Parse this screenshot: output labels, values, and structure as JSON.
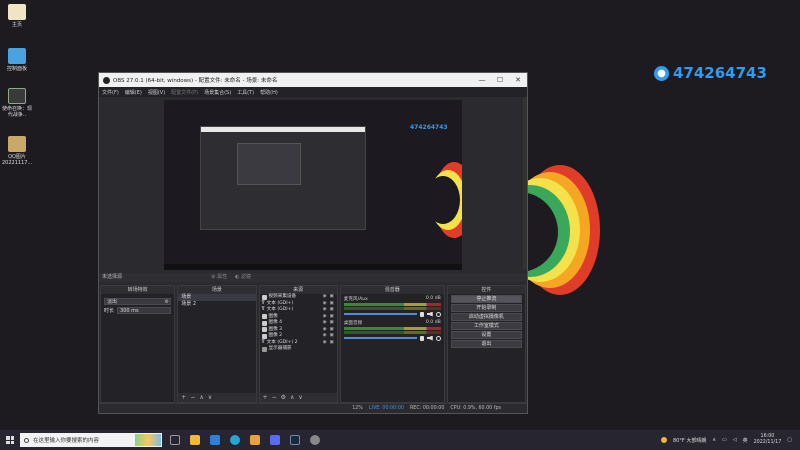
{
  "desktop": {
    "icons": [
      {
        "label": "主页",
        "color": "#f0e4c6"
      },
      {
        "label": "控制面板",
        "color": "#4aa3e0"
      },
      {
        "label": "使命召唤：现代战争..",
        "color": "#3a3a3a"
      },
      {
        "label": "QQ图片 20221117...",
        "color": "#c9a86a"
      }
    ],
    "qq_number": "474264743",
    "arc_colors": [
      "#e03c2a",
      "#f5a623",
      "#f5e14a",
      "#3aa85a"
    ]
  },
  "obs": {
    "title": "OBS 27.0.1 (64-bit, windows) - 配置文件: 未命名 - 场景: 未命名",
    "window_controls": [
      "—",
      "☐",
      "✕"
    ],
    "menu": [
      "文件(F)",
      "编辑(E)",
      "视图(V)",
      "配置文件(P)",
      "场景集合(S)",
      "工具(T)",
      "帮助(H)"
    ],
    "preview_qq": "474264743",
    "scene_bar": {
      "label": "未选择源",
      "props_button": "属性",
      "filters_button": "滤镜"
    },
    "transitions": {
      "title": "转场特效",
      "selected": "淡出",
      "duration_label": "时长",
      "duration_value": "300 ms"
    },
    "scenes": {
      "title": "场景",
      "items": [
        "场景",
        "场景 2"
      ]
    },
    "sources": {
      "title": "来源",
      "items": [
        {
          "label": "视频采集设备",
          "icon": "camera"
        },
        {
          "label": "文本 (GDI+)",
          "icon": "text"
        },
        {
          "label": "文本 (GDI+)",
          "icon": "text"
        },
        {
          "label": "图像",
          "icon": "image"
        },
        {
          "label": "图像 4",
          "icon": "image"
        },
        {
          "label": "图像 3",
          "icon": "image"
        },
        {
          "label": "图像 2",
          "icon": "image"
        },
        {
          "label": "文本 (GDI+) 2",
          "icon": "text"
        },
        {
          "label": "显示器捕获",
          "icon": "monitor"
        }
      ]
    },
    "mixer": {
      "title": "混音器",
      "tracks": [
        {
          "name": "麦克风/Aux",
          "db": "0.0 dB"
        },
        {
          "name": "桌面音频",
          "db": "0.0 dB"
        }
      ]
    },
    "controls": {
      "title": "控件",
      "buttons": [
        "停止推流",
        "开始录制",
        "启动虚拟摄像机",
        "工作室模式",
        "设置",
        "退出"
      ]
    },
    "status": {
      "live": "LIVE: 00:00:00",
      "rec": "REC: 00:00:00",
      "cpu": "CPU: 0.9%, 60.00 fps",
      "dropped": "12%"
    }
  },
  "taskbar": {
    "search_placeholder": "在这里输入你要搜索的内容",
    "app_colors": [
      "#999999",
      "#f2b93b",
      "#2f7fdb",
      "#28a4d9",
      "#e8a33c",
      "#5b6cf0",
      "#1b2838",
      "#888888"
    ],
    "weather": "80°F 大部晴朗",
    "lang": "英",
    "time": "16:00",
    "date": "2022/11/17"
  }
}
